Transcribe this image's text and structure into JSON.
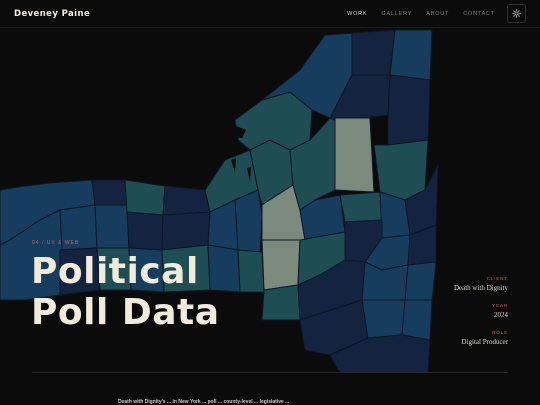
{
  "header": {
    "brand": "Deveney Paine",
    "nav": [
      {
        "label": "WORK"
      },
      {
        "label": "GALLERY"
      },
      {
        "label": "ABOUT"
      },
      {
        "label": "CONTACT"
      }
    ],
    "theme_toggle_icon": "sun-icon"
  },
  "hero": {
    "tag": "04 / UX & WEB",
    "title_line1": "Political",
    "title_line2": "Poll Data",
    "background_icon": "new-york-county-map",
    "meta": [
      {
        "label": "CLIENT",
        "value": "Death with Dignity"
      },
      {
        "label": "YEAR",
        "value": "2024"
      },
      {
        "label": "ROLE",
        "value": "Digital Producer"
      }
    ]
  },
  "intro_text": "Death with Dignity's ... in New York ... poll ... county-level ... legislative ...",
  "colors": {
    "background": "#0b0b0b",
    "accent": "#c7664d",
    "title": "#f1ebdc",
    "map_dark": "#142440",
    "map_mid": "#163c5e",
    "map_teal": "#1e4d54",
    "map_light": "#7b8a7c"
  }
}
